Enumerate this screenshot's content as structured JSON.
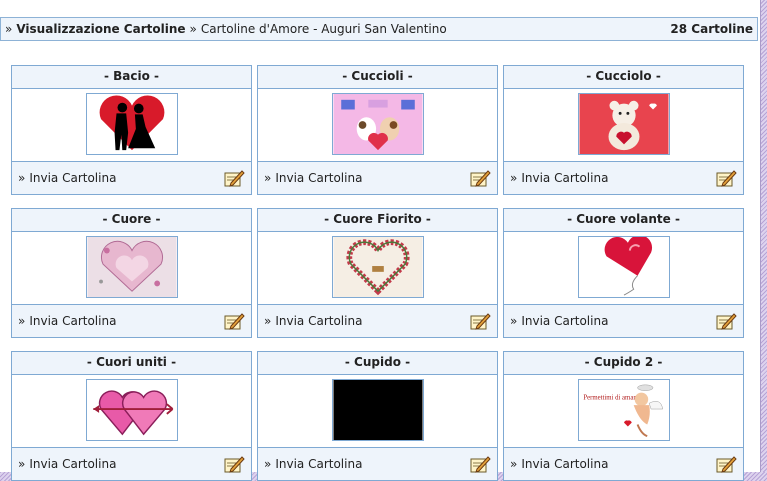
{
  "breadcrumb": {
    "sep": "»",
    "section": "Visualizzazione Cartoline",
    "category": "Cartoline d'Amore - Auguri San Valentino",
    "count": "28 Cartoline"
  },
  "action": {
    "arrow": "»",
    "label": "Invia Cartolina",
    "icon": "edit-pencil-icon"
  },
  "cards": [
    {
      "title": "- Bacio -"
    },
    {
      "title": "- Cuccioli -"
    },
    {
      "title": "- Cucciolo -"
    },
    {
      "title": "- Cuore -"
    },
    {
      "title": "- Cuore Fiorito -"
    },
    {
      "title": "- Cuore volante -"
    },
    {
      "title": "- Cuori uniti -"
    },
    {
      "title": "- Cupido -"
    },
    {
      "title": "- Cupido 2 -",
      "image_text": "Permettimi di amarti!!"
    }
  ],
  "colors": {
    "border": "#7fa9d3",
    "header_bg": "#eef4fb",
    "accent_red": "#d81a2a"
  }
}
